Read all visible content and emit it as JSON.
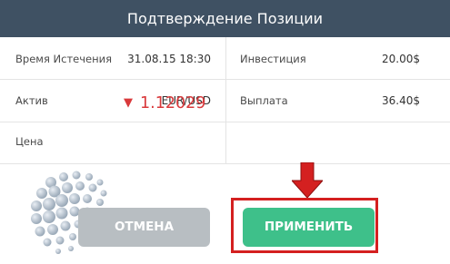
{
  "dialog": {
    "title": "Подтверждение Позиции"
  },
  "details": {
    "expiry": {
      "label": "Время Истечения",
      "value": "31.08.15 18:30"
    },
    "investment": {
      "label": "Инвестиция",
      "value": "20.00$"
    },
    "asset": {
      "label": "Актив",
      "value": "EUR/USD"
    },
    "payout": {
      "label": "Выплата",
      "value": "36.40$"
    },
    "price": {
      "label": "Цена",
      "value": "1.12029",
      "direction_icon": "down-triangle-icon",
      "color": "#d9393b"
    }
  },
  "buttons": {
    "cancel_label": "ОТМЕНА",
    "apply_label": "ПРИМЕНИТЬ"
  },
  "colors": {
    "header_bg": "#3f5163",
    "apply_bg": "#3ec08a",
    "cancel_bg": "#b8bec2",
    "highlight": "#d42020"
  }
}
